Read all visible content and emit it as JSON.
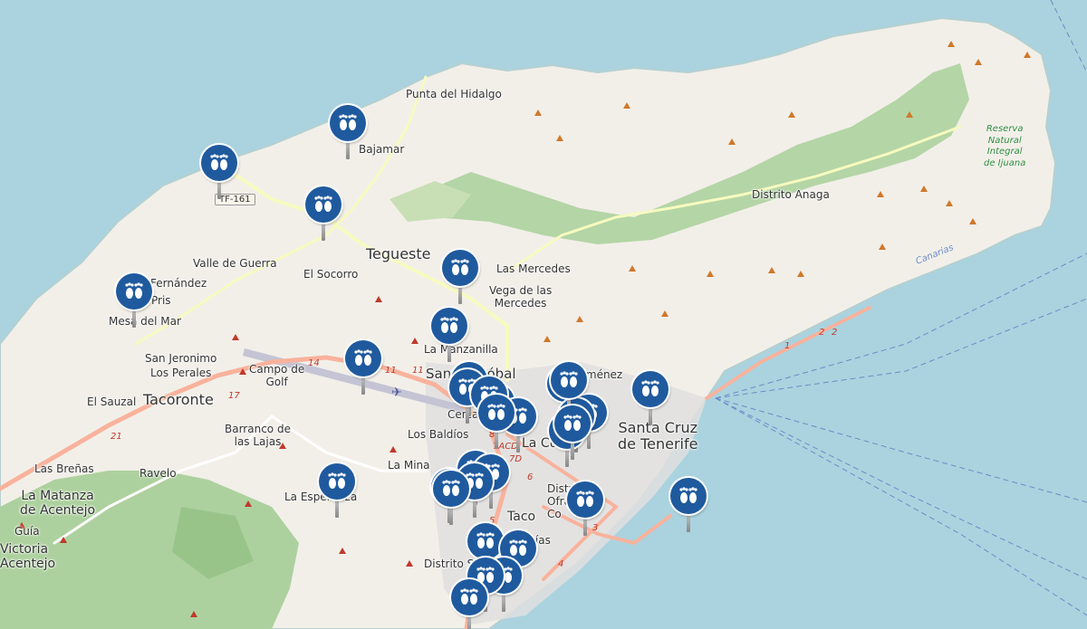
{
  "map": {
    "colors": {
      "sea": "#aad3df",
      "land": "#f2efe9",
      "forest": "#add19e",
      "primary_road": "#f9b29c",
      "secondary_road": "#f7fabf",
      "marker": "#1f5a9e"
    },
    "marker_icon": "footprints-icon",
    "place_labels": {
      "punta_del_hidalgo": "Punta del Hidalgo",
      "bajamar": "Bajamar",
      "tf161": "TF-161",
      "tegueste": "Tegueste",
      "valle_de_guerra": "Valle de Guerra",
      "el_socorro": "El Socorro",
      "fernandez": "Fernández",
      "pris": "Pris",
      "mesa_del_mar": "Mesa del Mar",
      "las_mercedes": "Las Mercedes",
      "vega_de_las_mercedes": "Vega de las\nMercedes",
      "la_manzanilla": "La Manzanilla",
      "san_jeronimo": "San Jeronimo",
      "los_perales": "Los Perales",
      "campo_de_golf": "Campo de\nGolf",
      "san_cristobal": "San Cristóbal\nde La",
      "jimenez": "Jiménez",
      "el_sauzal": "El Sauzal",
      "tacoronte": "Tacoronte",
      "barranco_de_las_lajas": "Barranco de\nlas Lajas",
      "los_baldios": "Los Baldíos",
      "cercado": "Cerca",
      "la_cuesta": "La Cu",
      "santa_cruz": "Santa Cruz\nde Tenerife",
      "las_brenas": "Las Breñas",
      "ravelo": "Ravelo",
      "la_mina": "La Mina",
      "la_esperanza": "La Esperanza",
      "la_matanza": "La Matanza\nde Acentejo",
      "guia": "Guía",
      "victoria": "Victoria\nAcentejo",
      "taco": "Taco",
      "distrito_sur": "Distrito S",
      "distrito_ofra": "Distrito\nOfra-\nCo",
      "distrito_anaga": "Distrito Anaga",
      "canarias": "Canarias",
      "reserva": "Reserva\nNatural\nIntegral\nde Ijuana",
      "rias": "rías"
    },
    "road_numbers": [
      "11",
      "11",
      "14",
      "17",
      "21",
      "8",
      "7ACD",
      "7D",
      "6",
      "5",
      "4",
      "3",
      "1",
      "2",
      "2"
    ],
    "markers_count": 33
  }
}
